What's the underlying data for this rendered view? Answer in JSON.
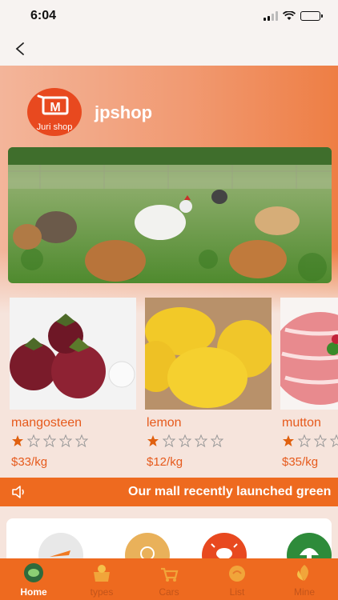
{
  "status_bar": {
    "time": "6:04"
  },
  "shop": {
    "name": "jpshop",
    "logo_text": "Juri shop"
  },
  "products": [
    {
      "name": "mangosteen",
      "rating": 1,
      "max_rating": 5,
      "price": "$33/kg"
    },
    {
      "name": "lemon",
      "rating": 1,
      "max_rating": 5,
      "price": "$12/kg"
    },
    {
      "name": "mutton",
      "rating": 1,
      "max_rating": 5,
      "price": "$35/kg"
    }
  ],
  "notice": {
    "text": "Our mall recently launched green"
  },
  "tabbar": {
    "items": [
      {
        "label": "Home",
        "icon": "home-icon",
        "active": true
      },
      {
        "label": "types",
        "icon": "types-icon",
        "active": false
      },
      {
        "label": "Cars",
        "icon": "cart-icon",
        "active": false
      },
      {
        "label": "List",
        "icon": "list-icon",
        "active": false
      },
      {
        "label": "Mine",
        "icon": "mine-icon",
        "active": false
      }
    ]
  },
  "colors": {
    "accent": "#ee6a1f",
    "price": "#e65a1c",
    "star": "#e0600f"
  }
}
